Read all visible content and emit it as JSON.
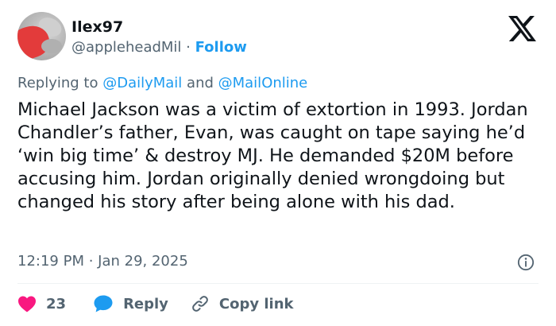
{
  "user": {
    "display_name": "Ilex97",
    "handle": "@appleheadMil",
    "separator": " · ",
    "follow_label": "Follow"
  },
  "reply_context": {
    "prefix": "Replying to ",
    "mention_1": "@DailyMail",
    "conjunction": " and ",
    "mention_2": "@MailOnline"
  },
  "tweet": {
    "text": "Michael Jackson was a victim of extortion in 1993. Jordan Chandler’s father, Evan, was caught on tape saying he’d ‘win big time’ & destroy MJ. He demanded $20M before accusing him. Jordan originally denied wrongdoing but changed his story after being alone with his dad.",
    "timestamp": "12:19 PM · Jan 29, 2025"
  },
  "actions": {
    "like_count": "23",
    "reply_label": "Reply",
    "copy_link_label": "Copy link"
  },
  "icons": {
    "logo": "x-logo-icon",
    "info": "info-icon",
    "like": "heart-icon",
    "reply": "speech-bubble-icon",
    "copy_link": "link-icon"
  },
  "colors": {
    "accent": "#1d9bf0",
    "like": "#f91880",
    "secondary_text": "#536471",
    "primary_text": "#0f1419"
  }
}
